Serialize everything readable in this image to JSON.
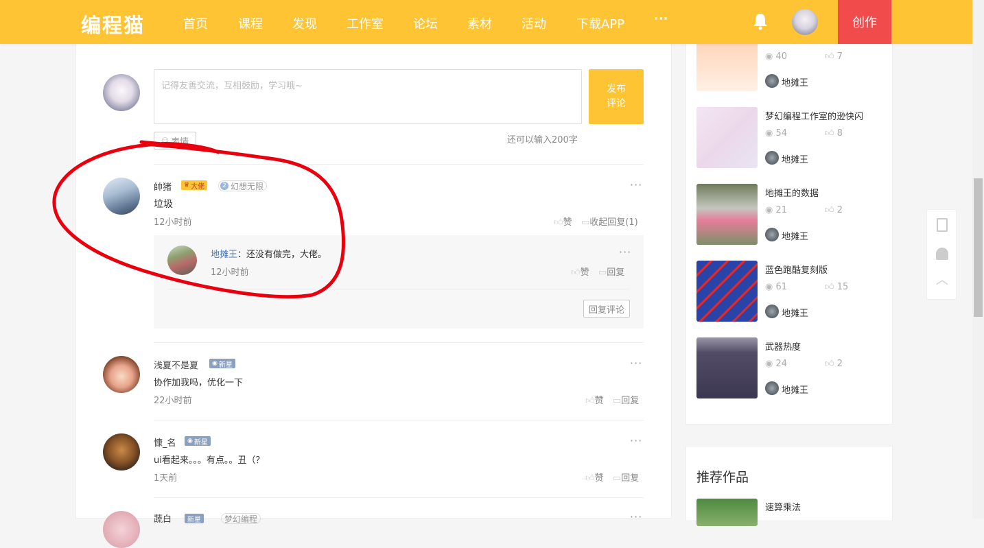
{
  "header": {
    "logo": "编程猫",
    "nav": [
      "首页",
      "课程",
      "发现",
      "工作室",
      "论坛",
      "素材",
      "活动",
      "下载APP"
    ],
    "more": "···",
    "create_label": "创作"
  },
  "comment_form": {
    "placeholder": "记得友善交流，互相鼓励，学习哦~",
    "publish_label_1": "发布",
    "publish_label_2": "评论",
    "emoji_label": "表情",
    "char_count": "还可以输入200字"
  },
  "comments": [
    {
      "user": "帥猪",
      "badge": "大佬",
      "level_badge": "幻想无限",
      "level_num": "2",
      "text": "垃圾",
      "time": "12小时前",
      "like": "赞",
      "reply_toggle": "收起回复(1)",
      "more": "···",
      "reply": {
        "user": "地摊王",
        "text": "：还没有做完，大佬。",
        "time": "12小时前",
        "like": "赞",
        "reply": "回复",
        "more": "···"
      },
      "reply_comment_label": "回复评论"
    },
    {
      "user": "浅夏不是夏",
      "badge": "新星",
      "text": "协作加我吗，优化一下",
      "time": "22小时前",
      "like": "赞",
      "reply": "回复",
      "more": "···"
    },
    {
      "user": "慷_名",
      "badge": "新星",
      "text": "ui看起来。。。有点。。丑（？",
      "time": "1天前",
      "like": "赞",
      "reply": "回复",
      "more": "···"
    },
    {
      "user": "蔬白",
      "badge": "新星",
      "level_badge": "梦幻编程",
      "more": "···"
    }
  ],
  "sidebar": {
    "works": [
      {
        "title": "",
        "views": "40",
        "likes": "7",
        "author": "地摊王"
      },
      {
        "title": "梦幻编程工作室的逊快闪",
        "views": "54",
        "likes": "8",
        "author": "地摊王"
      },
      {
        "title": "地摊王的数据",
        "views": "21",
        "likes": "2",
        "author": "地摊王"
      },
      {
        "title": "蓝色跑酷复刻版",
        "views": "61",
        "likes": "15",
        "author": "地摊王"
      },
      {
        "title": "武器热度",
        "views": "24",
        "likes": "2",
        "author": "地摊王"
      }
    ],
    "recommend_title": "推荐作品",
    "recommend_first": "速算乘法"
  },
  "colors": {
    "brand": "#fec433",
    "create": "#f24b4b",
    "annotation": "#e8000f"
  }
}
